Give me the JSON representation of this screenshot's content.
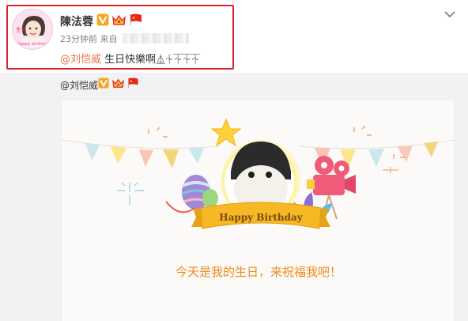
{
  "post": {
    "username": "陳法蓉",
    "time": "23分钟前",
    "source_prefix": "来自",
    "mention": "@刘恺威",
    "text": " 生日快樂啊",
    "tail_glyphs": "⏅⏆⏇⏇⏇",
    "avatar_text": [
      "生日",
      "Happy birthday"
    ]
  },
  "repost": {
    "author": "@刘恺威"
  },
  "card": {
    "banner_text": "Happy Birthday",
    "message": "今天是我的生日，来祝福我吧！"
  },
  "icons": {
    "verified": "verified-v-icon",
    "crown": "crown-badge-icon",
    "flag": "china-flag-icon",
    "chevron": "chevron-down-icon"
  },
  "colors": {
    "highlight": "#d9262c",
    "mention": "#eb7350",
    "message": "#f08b1a",
    "repost_bg": "#f2f2f5"
  }
}
